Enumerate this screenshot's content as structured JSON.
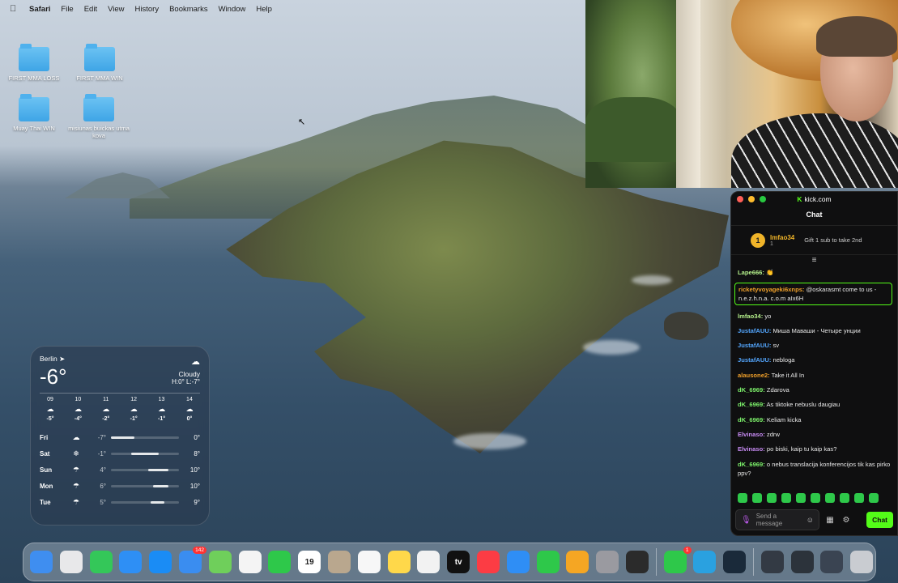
{
  "menubar": {
    "app_name": "Safari",
    "items": [
      "File",
      "Edit",
      "View",
      "History",
      "Bookmarks",
      "Window",
      "Help"
    ]
  },
  "desktop": {
    "icons": [
      {
        "label": "FIRST MMA LOSS"
      },
      {
        "label": "FIRST MMA WIN"
      },
      {
        "label": "Muay Thai WIN"
      },
      {
        "label": "misiunas buickas utma kova"
      }
    ]
  },
  "weather": {
    "city": "Berlin",
    "temperature": "-6°",
    "condition": "Cloudy",
    "hilo": "H:0° L:-7°",
    "hourly": [
      {
        "hour": "09",
        "temp": "-5°"
      },
      {
        "hour": "10",
        "temp": "-4°"
      },
      {
        "hour": "11",
        "temp": "-2°"
      },
      {
        "hour": "12",
        "temp": "-1°"
      },
      {
        "hour": "13",
        "temp": "-1°"
      },
      {
        "hour": "14",
        "temp": "0°"
      }
    ],
    "daily": [
      {
        "day": "Fri",
        "icon": "cloud-icon",
        "low": "-7°",
        "high": "0°",
        "range_start": 0.0,
        "range_end": 0.35
      },
      {
        "day": "Sat",
        "icon": "snow-cloud-icon",
        "low": "-1°",
        "high": "8°",
        "range_start": 0.3,
        "range_end": 0.7
      },
      {
        "day": "Sun",
        "icon": "rain-cloud-icon",
        "low": "4°",
        "high": "10°",
        "range_start": 0.55,
        "range_end": 0.85
      },
      {
        "day": "Mon",
        "icon": "rain-cloud-icon",
        "low": "6°",
        "high": "10°",
        "range_start": 0.62,
        "range_end": 0.85
      },
      {
        "day": "Tue",
        "icon": "rain-cloud-icon",
        "low": "5°",
        "high": "9°",
        "range_start": 0.58,
        "range_end": 0.78
      }
    ]
  },
  "kick": {
    "site": "kick.com",
    "chat_title": "Chat",
    "gift": {
      "rank": "1",
      "user": "lmfao34",
      "count": "1",
      "text": "Gift 1 sub to take 2nd"
    },
    "messages": [
      {
        "user": "Lape666:",
        "text": "👏",
        "color": "#b6f28c"
      },
      {
        "user": "ricketyvoyageki6xnps:",
        "text": "@oskarasmt come to us - n.e.z.h.n.a. c.o.m aIx6H",
        "color": "#f0a02a",
        "highlight": true
      },
      {
        "user": "lmfao34:",
        "text": "yo",
        "color": "#b6f28c"
      },
      {
        "user": "JustafAUU:",
        "text": "Миша Маваши - Четыре унции",
        "color": "#54a7ff"
      },
      {
        "user": "JustafAUU:",
        "text": "sv",
        "color": "#54a7ff"
      },
      {
        "user": "JustafAUU:",
        "text": "nebloga",
        "color": "#54a7ff"
      },
      {
        "user": "alausone2:",
        "text": "Take it All In",
        "color": "#f0a02a"
      },
      {
        "user": "dK_6969:",
        "text": "Zdarova",
        "color": "#7cf06a"
      },
      {
        "user": "dK_6969:",
        "text": "As tiktoke nebuslu daugiau",
        "color": "#7cf06a"
      },
      {
        "user": "dK_6969:",
        "text": "Keliam kicka",
        "color": "#7cf06a"
      },
      {
        "user": "Elvinaso:",
        "text": "zdrw",
        "color": "#c98cf5"
      },
      {
        "user": "Elvinaso:",
        "text": "po biski, kaip tu kaip kas?",
        "color": "#c98cf5"
      },
      {
        "user": "dK_6969:",
        "text": "o nebus translacija konferencijos tik kas pirko ppv?",
        "color": "#7cf06a"
      }
    ],
    "input_placeholder": "Send a message",
    "chat_button": "Chat"
  },
  "dock": {
    "apps": [
      {
        "name": "finder-icon",
        "color": "#3f8ef0"
      },
      {
        "name": "launchpad-icon",
        "color": "#e8e8ea"
      },
      {
        "name": "messages-icon",
        "color": "#34c759"
      },
      {
        "name": "safari-icon",
        "color": "#2e8ff5"
      },
      {
        "name": "app-store-icon",
        "color": "#1a8cf5"
      },
      {
        "name": "mail-icon",
        "color": "#3a8df0",
        "badge": "142"
      },
      {
        "name": "maps-icon",
        "color": "#6fcf5b"
      },
      {
        "name": "photos-icon",
        "color": "#f4f4f4"
      },
      {
        "name": "facetime-icon",
        "color": "#2ec84a"
      },
      {
        "name": "calendar-icon",
        "color": "#ffffff",
        "label": "19"
      },
      {
        "name": "contacts-icon",
        "color": "#b9a78e"
      },
      {
        "name": "reminders-icon",
        "color": "#f7f7f7"
      },
      {
        "name": "notes-icon",
        "color": "#ffd84a"
      },
      {
        "name": "freeform-icon",
        "color": "#f2f2f2"
      },
      {
        "name": "apple-tv-icon",
        "color": "#111111",
        "label": "tv"
      },
      {
        "name": "music-icon",
        "color": "#fc3c44"
      },
      {
        "name": "keynote-icon",
        "color": "#2f8ef5"
      },
      {
        "name": "numbers-icon",
        "color": "#2ec84a"
      },
      {
        "name": "pages-icon",
        "color": "#f5a623"
      },
      {
        "name": "system-settings-icon",
        "color": "#9a9aa0"
      },
      {
        "name": "obs-icon",
        "color": "#2b2b2b"
      },
      {
        "name": "whatsapp-icon",
        "color": "#2ec84a",
        "badge": "1"
      },
      {
        "name": "telegram-icon",
        "color": "#2aa1e0"
      },
      {
        "name": "league-of-legends-icon",
        "color": "#1a2a3a"
      },
      {
        "name": "recent-window-icon",
        "color": "#333a44"
      },
      {
        "name": "recent-window-icon-2",
        "color": "#2c333b"
      },
      {
        "name": "recent-window-icon-3",
        "color": "#3a4452"
      },
      {
        "name": "trash-icon",
        "color": "#c9ccd1"
      }
    ]
  }
}
